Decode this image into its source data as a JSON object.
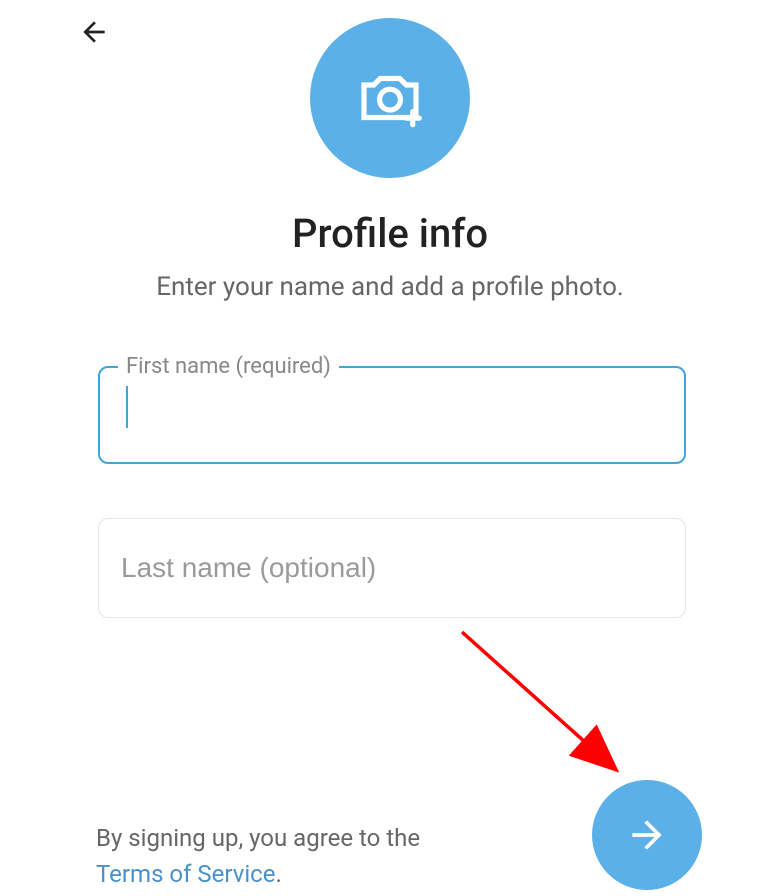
{
  "header": {
    "title": "Profile info",
    "subtitle": "Enter your name and add a profile photo."
  },
  "form": {
    "first_name": {
      "label": "First name (required)",
      "value": ""
    },
    "last_name": {
      "placeholder": "Last name (optional)",
      "value": ""
    }
  },
  "tos": {
    "prefix": "By signing up, you agree to the ",
    "link_text": "Terms of Service",
    "suffix": "."
  },
  "colors": {
    "accent": "#5bb0e8",
    "border_active": "#3fa6da",
    "annotation_arrow": "#ff0000"
  }
}
